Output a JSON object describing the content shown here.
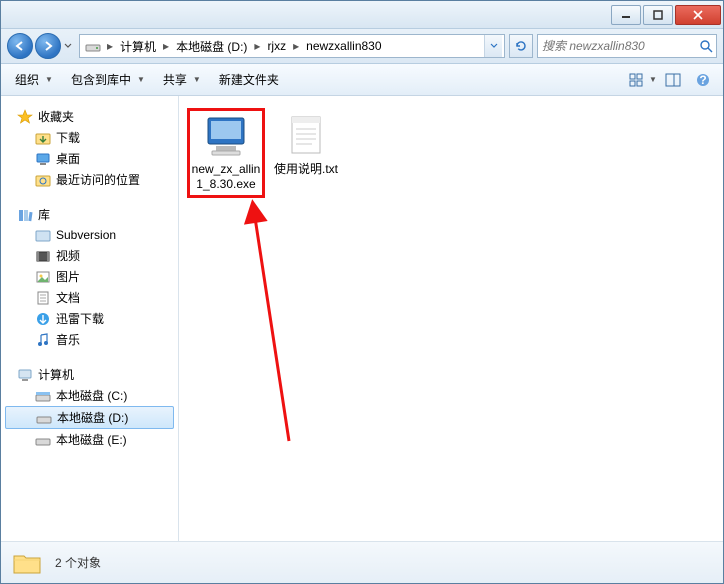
{
  "breadcrumbs": {
    "root": "计算机",
    "drive": "本地磁盘 (D:)",
    "folder1": "rjxz",
    "folder2": "newzxallin830"
  },
  "search": {
    "placeholder": "搜索 newzxallin830"
  },
  "toolbar": {
    "organize": "组织",
    "include": "包含到库中",
    "share": "共享",
    "newfolder": "新建文件夹"
  },
  "sidebar": {
    "favorites": {
      "header": "收藏夹",
      "downloads": "下载",
      "desktop": "桌面",
      "recent": "最近访问的位置"
    },
    "libraries": {
      "header": "库",
      "subversion": "Subversion",
      "videos": "视频",
      "pictures": "图片",
      "documents": "文档",
      "xunlei": "迅雷下载",
      "music": "音乐"
    },
    "computer": {
      "header": "计算机",
      "c": "本地磁盘 (C:)",
      "d": "本地磁盘 (D:)",
      "e": "本地磁盘 (E:)"
    }
  },
  "files": {
    "exe": "new_zx_allin1_8.30.exe",
    "txt": "使用说明.txt"
  },
  "status": {
    "count": "2 个对象"
  }
}
